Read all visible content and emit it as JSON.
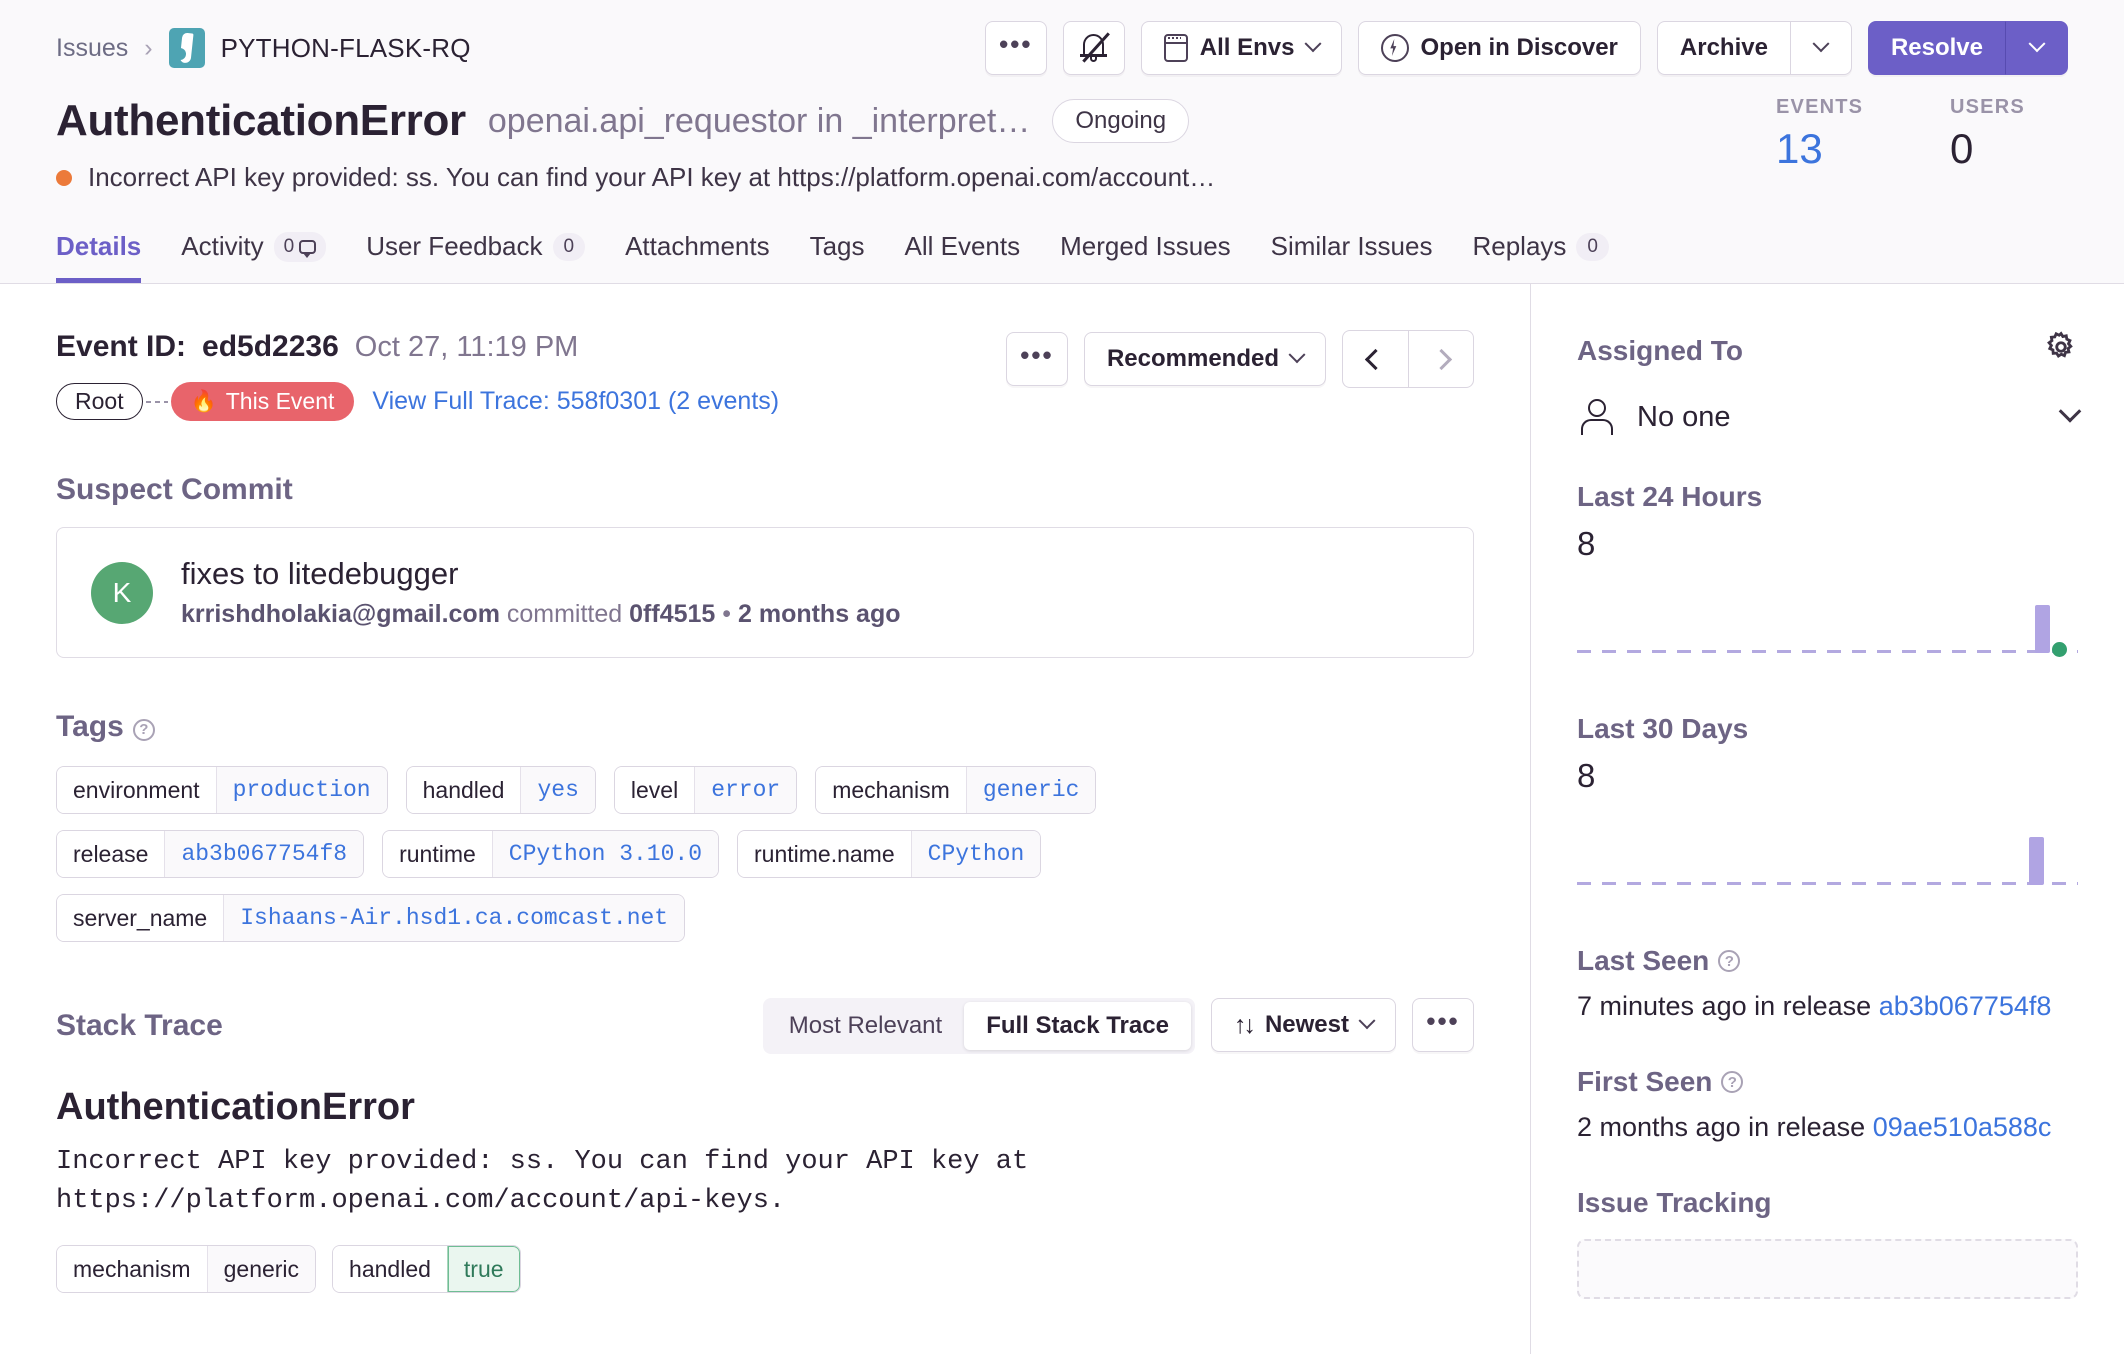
{
  "header": {
    "breadcrumb": {
      "issues_label": "Issues",
      "separator": "›",
      "project_name": "PYTHON-FLASK-RQ"
    },
    "actions": {
      "more_label": "•••",
      "mute_icon": "bell-slash-icon",
      "env_label": "All Envs",
      "discover_label": "Open in Discover",
      "archive_label": "Archive",
      "resolve_label": "Resolve"
    },
    "title": {
      "error_type": "AuthenticationError",
      "location": "openai.api_requestor in _interpret…",
      "status_badge": "Ongoing",
      "culprit": "Incorrect API key provided: ss. You can find your API key at https://platform.openai.com/account…",
      "level_color": "#ec7a3a"
    },
    "stats": [
      {
        "label": "EVENTS",
        "value": "13",
        "link": true
      },
      {
        "label": "USERS",
        "value": "0",
        "link": false
      }
    ],
    "tabs": [
      {
        "label": "Details",
        "badge": null,
        "active": true
      },
      {
        "label": "Activity",
        "badge": "0",
        "comment_icon": true,
        "active": false
      },
      {
        "label": "User Feedback",
        "badge": "0",
        "active": false
      },
      {
        "label": "Attachments",
        "badge": null,
        "active": false
      },
      {
        "label": "Tags",
        "badge": null,
        "active": false
      },
      {
        "label": "All Events",
        "badge": null,
        "active": false
      },
      {
        "label": "Merged Issues",
        "badge": null,
        "active": false
      },
      {
        "label": "Similar Issues",
        "badge": null,
        "active": false
      },
      {
        "label": "Replays",
        "badge": "0",
        "active": false
      }
    ]
  },
  "main": {
    "event": {
      "id_label": "Event ID:",
      "id_value": "ed5d2236",
      "date": "Oct 27, 11:19 PM",
      "root_pill": "Root",
      "this_event_pill": "This Event",
      "trace_link": "View Full Trace: 558f0301 (2 events)",
      "more_label": "•••",
      "recommended_label": "Recommended"
    },
    "suspect_commit": {
      "section_title": "Suspect Commit",
      "avatar_initial": "K",
      "message": "fixes to litedebugger",
      "author": "krrishdholakia@gmail.com",
      "committed_word": "committed",
      "sha": "0ff4515",
      "separator": "•",
      "time_ago": "2 months ago"
    },
    "tags_section": {
      "title": "Tags",
      "tags": [
        {
          "key": "environment",
          "value": "production"
        },
        {
          "key": "handled",
          "value": "yes"
        },
        {
          "key": "level",
          "value": "error"
        },
        {
          "key": "mechanism",
          "value": "generic"
        },
        {
          "key": "release",
          "value": "ab3b067754f8"
        },
        {
          "key": "runtime",
          "value": "CPython 3.10.0"
        },
        {
          "key": "runtime.name",
          "value": "CPython"
        },
        {
          "key": "server_name",
          "value": "Ishaans-Air.hsd1.ca.comcast.net"
        }
      ]
    },
    "stack_trace": {
      "title": "Stack Trace",
      "segments": [
        {
          "label": "Most Relevant",
          "active": false
        },
        {
          "label": "Full Stack Trace",
          "active": true
        }
      ],
      "sort_label": "Newest",
      "sort_icon": "↑↓",
      "more_label": "•••",
      "error_heading": "AuthenticationError",
      "error_message": "Incorrect API key provided: ss. You can find your API key at https://platform.openai.com/account/api-keys.",
      "error_tags": [
        {
          "key": "mechanism",
          "value": "generic",
          "highlight": false
        },
        {
          "key": "handled",
          "value": "true",
          "highlight": true
        }
      ]
    }
  },
  "sidebar": {
    "assigned": {
      "title": "Assigned To",
      "value": "No one",
      "gear_icon": "gear-icon"
    },
    "last_24_hours": {
      "title": "Last 24 Hours",
      "count": "8"
    },
    "last_30_days": {
      "title": "Last 30 Days",
      "count": "8"
    },
    "last_seen": {
      "title": "Last Seen",
      "time": "7 minutes ago",
      "in_release": "in release",
      "release": "ab3b067754f8"
    },
    "first_seen": {
      "title": "First Seen",
      "time": "2 months ago",
      "in_release": "in release",
      "release": "09ae510a588c"
    },
    "issue_tracking": {
      "title": "Issue Tracking"
    }
  },
  "chart_data": [
    {
      "type": "bar",
      "title": "Last 24 Hours",
      "total": 8,
      "categories": [
        "h1",
        "h2",
        "h3",
        "h4",
        "h5",
        "h6",
        "h7",
        "h8",
        "h9",
        "h10",
        "h11",
        "h12",
        "h13",
        "h14",
        "h15",
        "h16",
        "h17",
        "h18",
        "h19",
        "h20",
        "h21",
        "h22",
        "h23",
        "h24"
      ],
      "values": [
        0,
        0,
        0,
        0,
        0,
        0,
        0,
        0,
        0,
        0,
        0,
        0,
        0,
        0,
        0,
        0,
        0,
        0,
        0,
        0,
        0,
        0,
        0,
        8
      ],
      "ylim": [
        0,
        8
      ],
      "grid": false,
      "legend": "none",
      "marker": {
        "type": "current-point",
        "at_category": "h24",
        "color": "#33a06f"
      },
      "bar_color": "#b0a4e3",
      "baseline_style": "dashed"
    },
    {
      "type": "bar",
      "title": "Last 30 Days",
      "total": 8,
      "categories": [
        "d1",
        "d2",
        "d3",
        "d4",
        "d5",
        "d6",
        "d7",
        "d8",
        "d9",
        "d10",
        "d11",
        "d12",
        "d13",
        "d14",
        "d15",
        "d16",
        "d17",
        "d18",
        "d19",
        "d20",
        "d21",
        "d22",
        "d23",
        "d24",
        "d25",
        "d26",
        "d27",
        "d28",
        "d29",
        "d30"
      ],
      "values": [
        0,
        0,
        0,
        0,
        0,
        0,
        0,
        0,
        0,
        0,
        0,
        0,
        0,
        0,
        0,
        0,
        0,
        0,
        0,
        0,
        0,
        0,
        0,
        0,
        0,
        0,
        0,
        0,
        0,
        8
      ],
      "ylim": [
        0,
        8
      ],
      "grid": false,
      "legend": "none",
      "bar_color": "#b0a4e3",
      "baseline_style": "dashed"
    }
  ]
}
